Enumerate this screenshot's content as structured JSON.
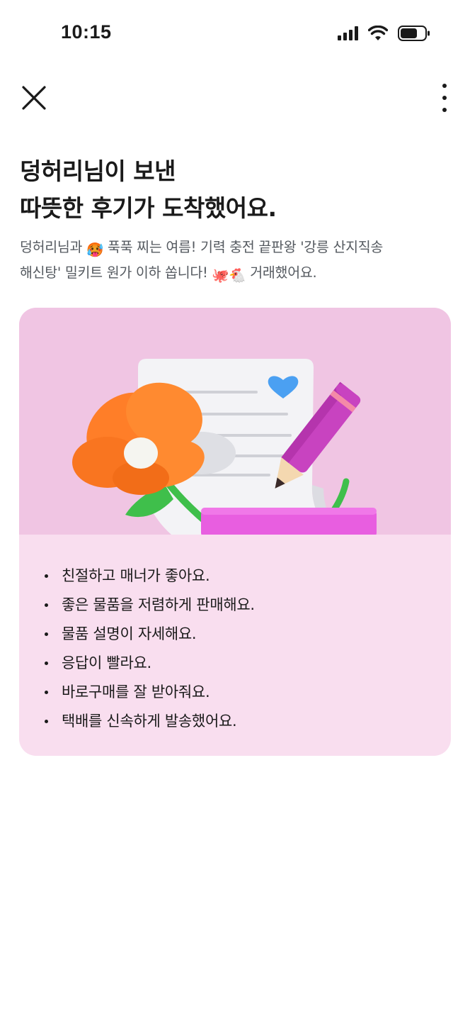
{
  "status_bar": {
    "time": "10:15"
  },
  "icons": {
    "close": "close-icon",
    "more": "more-vertical-icon",
    "signal": "signal-icon",
    "wifi": "wifi-icon",
    "battery": "battery-icon"
  },
  "headline": {
    "line1": "덩허리님이 보낸",
    "line2": "따뜻한 후기가 도착했어요."
  },
  "description": {
    "line1_prefix": "덩허리님과",
    "line1_emoji": "🥵",
    "line1_suffix": "푹푹 찌는 여름! 기력 충전 끝판왕 '강릉 산지직송",
    "line2_prefix": "해신탕' 밀키트 원가 이하 쏩니다!",
    "line2_emoji1": "🐙",
    "line2_emoji2": "🐔",
    "line2_suffix": "거래했어요."
  },
  "card": {
    "illustration": "letter-flower-pencil-illustration",
    "colors": {
      "illustration_bg": "#f0c5e3",
      "list_bg": "#f9deef"
    },
    "items": [
      "친절하고 매너가 좋아요.",
      "좋은 물품을 저렴하게 판매해요.",
      "물품 설명이 자세해요.",
      "응답이 빨라요.",
      "바로구매를 잘 받아줘요.",
      "택배를 신속하게 발송했어요."
    ]
  }
}
